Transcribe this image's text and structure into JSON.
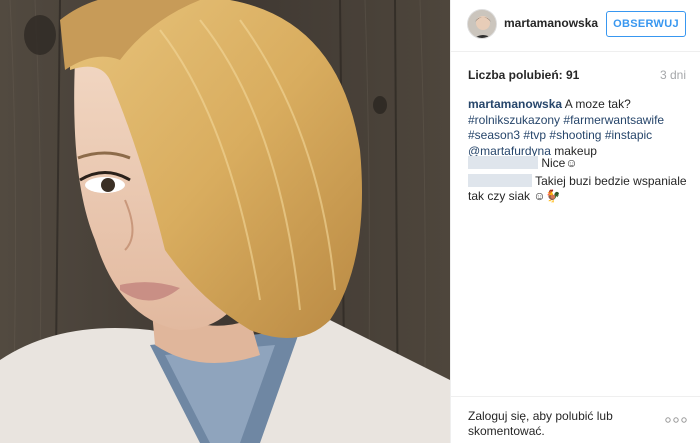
{
  "post": {
    "image_alt": "selfie of blonde woman with bob haircut"
  },
  "header": {
    "username": "martamanowska",
    "follow_label": "OBSERWUJ"
  },
  "meta": {
    "likes": "Liczba polubień: 91",
    "time": "3 dni"
  },
  "caption": {
    "user": "martamanowska",
    "text": " A moze tak?",
    "tags": [
      "#rolnikszukazony",
      "#farmerwantsawife",
      "#season3",
      "#tvp",
      "#shooting",
      "#instapic",
      "@martafurdyna"
    ],
    "tail": " makeup"
  },
  "comments": [
    {
      "text": "Nice☺"
    },
    {
      "text": "Takiej buzi bedzie wspaniale tak czy siak ☺🐓"
    }
  ],
  "footer": {
    "login_text": "Zaloguj się, aby polubić lub skomentować."
  },
  "colors": {
    "accent": "#3897f0",
    "link": "#27466b",
    "muted": "#a5a7aa"
  }
}
